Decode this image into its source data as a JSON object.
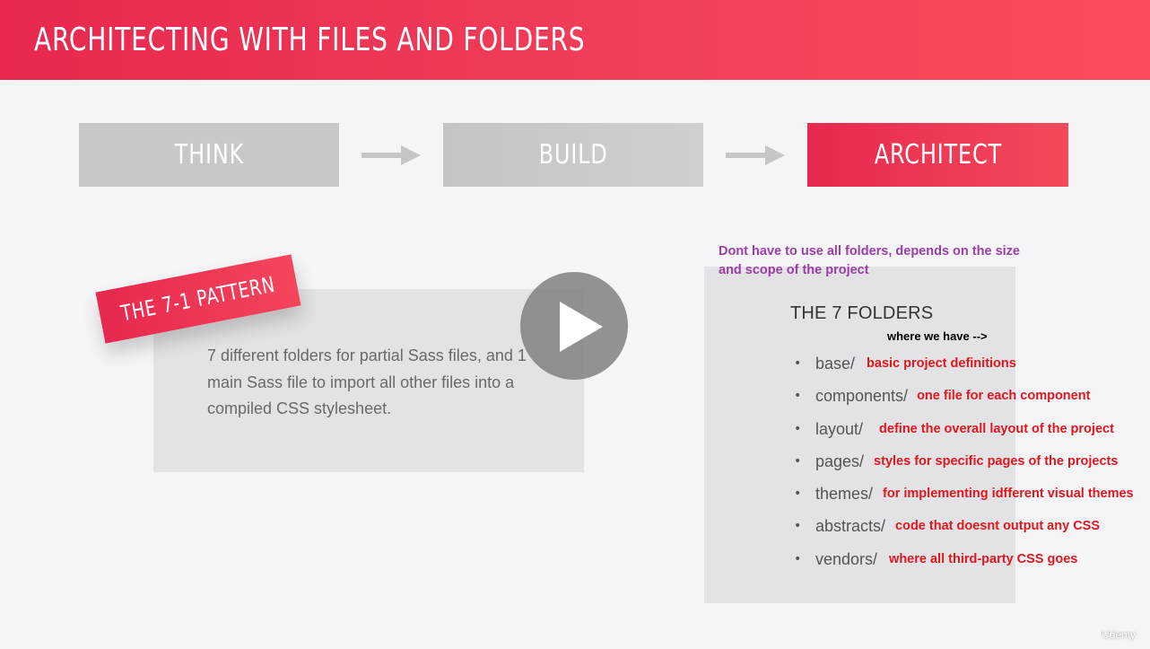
{
  "header": {
    "title": "Architecting with files and folders"
  },
  "steps": [
    {
      "label": "THINK"
    },
    {
      "label": "BUILD"
    },
    {
      "label": "ARCHITECT"
    }
  ],
  "colors": {
    "accent": "#ee3456",
    "step_inactive": "#c8c7c9",
    "note_purple": "#9b3ea8",
    "note_red": "#e1171d"
  },
  "pattern": {
    "ribbon": "THE 7-1 PATTERN",
    "description": "7 different folders for partial Sass files, and 1 main Sass file to import all other files into a compiled CSS stylesheet."
  },
  "video": {
    "play_icon": "play-icon"
  },
  "annotation_top": "Dont have to use all folders, depends on the size and scope of the project",
  "folders": {
    "title": "THE 7 FOLDERS",
    "where_note": "where we have -->",
    "items": [
      {
        "name": "base/",
        "note": "basic project definitions"
      },
      {
        "name": "components/",
        "note": "one file for each component"
      },
      {
        "name": "layout/",
        "note": "define the overall layout of the project"
      },
      {
        "name": "pages/",
        "note": "styles for specific pages of the projects"
      },
      {
        "name": "themes/",
        "note": "for implementing idfferent visual themes"
      },
      {
        "name": "abstracts/",
        "note": "code that doesnt output any CSS"
      },
      {
        "name": "vendors/",
        "note": "where all third-party CSS goes"
      }
    ]
  },
  "watermark": "Udemy"
}
